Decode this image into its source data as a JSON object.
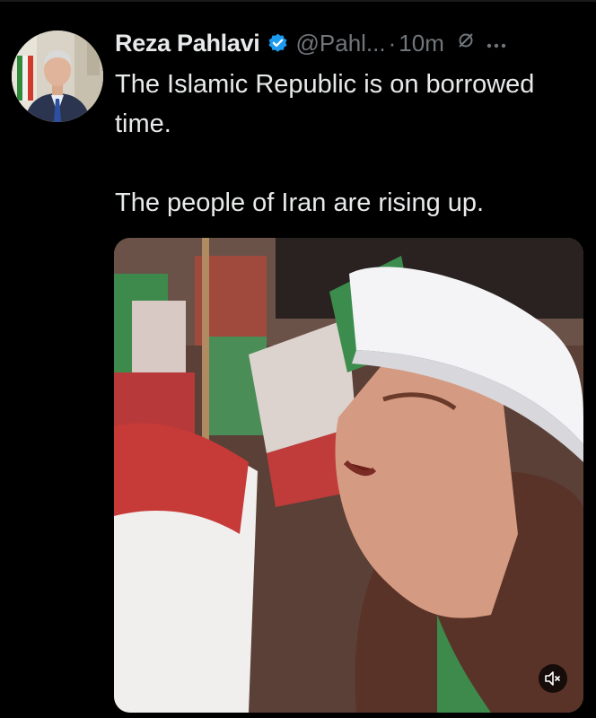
{
  "tweet": {
    "author_name": "Reza Pahlavi",
    "handle": "@Pahl...",
    "separator": "·",
    "time": "10m",
    "paragraphs": [
      "The Islamic Republic is on borrowed time.",
      "The people of Iran are rising up."
    ]
  },
  "icons": {
    "verified": "verified-badge-icon",
    "grok": "grok-icon",
    "more": "more-options-icon",
    "mute": "muted-speaker-icon"
  },
  "colors": {
    "background": "#000000",
    "text": "#e7e9ea",
    "secondary": "#71767b",
    "verified": "#1d9bf0"
  }
}
